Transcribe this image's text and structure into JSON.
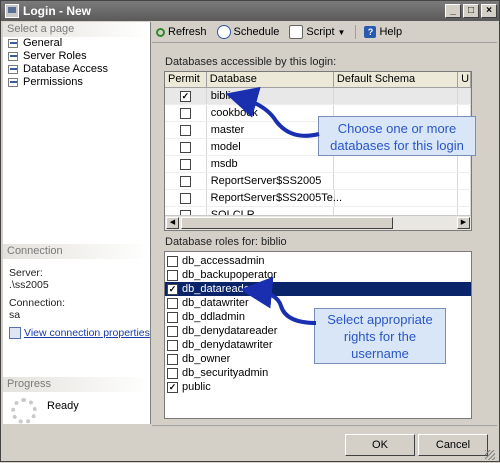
{
  "window": {
    "title": "Login - New"
  },
  "left_panel": {
    "select_header": "Select a page",
    "pages": [
      "General",
      "Server Roles",
      "Database Access",
      "Permissions"
    ],
    "connection_header": "Connection",
    "server_label": "Server:",
    "server_value": ".\\ss2005",
    "connection_label": "Connection:",
    "connection_value": "sa",
    "view_link": "View connection properties",
    "progress_header": "Progress",
    "progress_status": "Ready"
  },
  "toolbar": {
    "refresh": "Refresh",
    "schedule": "Schedule",
    "script": "Script",
    "help": "Help"
  },
  "databases": {
    "label": "Databases accessible by this login:",
    "headers": [
      "Permit",
      "Database",
      "Default Schema",
      "U"
    ],
    "rows": [
      {
        "permit": true,
        "name": "biblio"
      },
      {
        "permit": false,
        "name": "cookbook"
      },
      {
        "permit": false,
        "name": "master"
      },
      {
        "permit": false,
        "name": "model"
      },
      {
        "permit": false,
        "name": "msdb"
      },
      {
        "permit": false,
        "name": "ReportServer$SS2005"
      },
      {
        "permit": false,
        "name": "ReportServer$SS2005Te..."
      },
      {
        "permit": false,
        "name": "SQLCLR"
      }
    ]
  },
  "roles": {
    "label": "Database roles for: biblio",
    "items": [
      {
        "name": "db_accessadmin",
        "checked": false
      },
      {
        "name": "db_backupoperator",
        "checked": false
      },
      {
        "name": "db_datareader",
        "checked": true
      },
      {
        "name": "db_datawriter",
        "checked": false
      },
      {
        "name": "db_ddladmin",
        "checked": false
      },
      {
        "name": "db_denydatareader",
        "checked": false
      },
      {
        "name": "db_denydatawriter",
        "checked": false
      },
      {
        "name": "db_owner",
        "checked": false
      },
      {
        "name": "db_securityadmin",
        "checked": false
      },
      {
        "name": "public",
        "checked": true
      }
    ],
    "selected_index": 2
  },
  "callouts": {
    "databases": "Choose one or more databases for this login",
    "roles": "Select appropriate rights for the username"
  },
  "buttons": {
    "ok": "OK",
    "cancel": "Cancel"
  },
  "colors": {
    "selection": "#0a246a",
    "callout_text": "#2a56c6",
    "arrow": "#1a2fb0"
  }
}
